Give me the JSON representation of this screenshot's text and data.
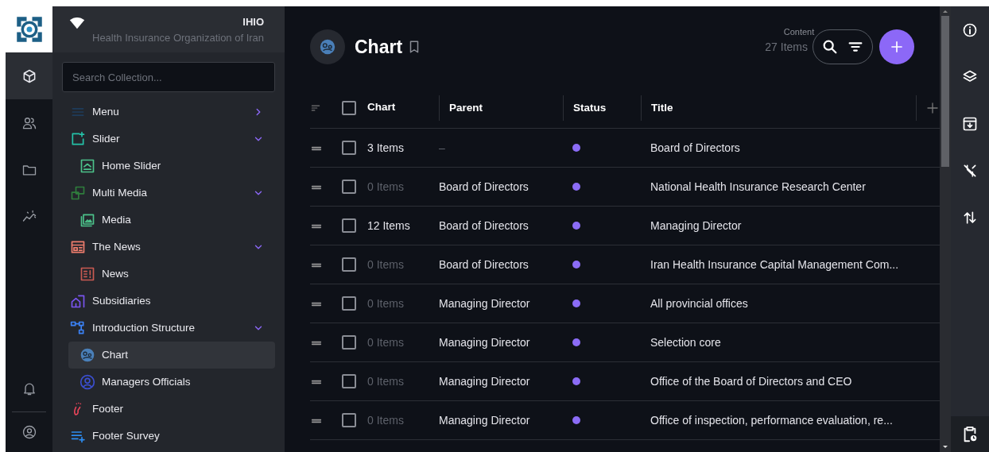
{
  "brand": {
    "title": "IHIO",
    "subtitle": "Health Insurance Organization of Iran"
  },
  "search": {
    "placeholder": "Search Collection..."
  },
  "nav": [
    {
      "label": "Menu",
      "expanded": false,
      "selected": false
    },
    {
      "label": "Slider",
      "expanded": true,
      "selected": false,
      "children": [
        {
          "label": "Home Slider",
          "selected": false
        }
      ]
    },
    {
      "label": "Multi Media",
      "expanded": true,
      "selected": false,
      "children": [
        {
          "label": "Media",
          "selected": false
        }
      ]
    },
    {
      "label": "The News",
      "expanded": true,
      "selected": false,
      "children": [
        {
          "label": "News",
          "selected": false
        }
      ]
    },
    {
      "label": "Subsidiaries",
      "selected": false
    },
    {
      "label": "Introduction Structure",
      "expanded": true,
      "selected": false,
      "children": [
        {
          "label": "Chart",
          "selected": true
        },
        {
          "label": "Managers Officials",
          "selected": false
        }
      ]
    },
    {
      "label": "Footer",
      "selected": false
    },
    {
      "label": "Footer Survey",
      "selected": false
    }
  ],
  "page": {
    "title": "Chart",
    "section": "Content",
    "count": "27 Items"
  },
  "table": {
    "all_checked": false,
    "columns": [
      "Chart",
      "Parent",
      "Status",
      "Title"
    ],
    "rows": [
      {
        "chart": "3 Items",
        "chart_dim": false,
        "parent": "–",
        "parent_dim": true,
        "title": "Board of Directors",
        "checked": false
      },
      {
        "chart": "0 Items",
        "chart_dim": true,
        "parent": "Board of Directors",
        "parent_dim": false,
        "title": "National Health Insurance Research Center",
        "checked": false
      },
      {
        "chart": "12 Items",
        "chart_dim": false,
        "parent": "Board of Directors",
        "parent_dim": false,
        "title": "Managing Director",
        "checked": false
      },
      {
        "chart": "0 Items",
        "chart_dim": true,
        "parent": "Board of Directors",
        "parent_dim": false,
        "title": "Iran Health Insurance Capital Management Com...",
        "checked": false
      },
      {
        "chart": "0 Items",
        "chart_dim": true,
        "parent": "Managing Director",
        "parent_dim": false,
        "title": "All provincial offices",
        "checked": false
      },
      {
        "chart": "0 Items",
        "chart_dim": true,
        "parent": "Managing Director",
        "parent_dim": false,
        "title": "Selection core",
        "checked": false
      },
      {
        "chart": "0 Items",
        "chart_dim": true,
        "parent": "Managing Director",
        "parent_dim": false,
        "title": "Office of the Board of Directors and CEO",
        "checked": false
      },
      {
        "chart": "0 Items",
        "chart_dim": true,
        "parent": "Managing Director",
        "parent_dim": false,
        "title": "Office of inspection, performance evaluation, re...",
        "checked": false
      }
    ]
  }
}
